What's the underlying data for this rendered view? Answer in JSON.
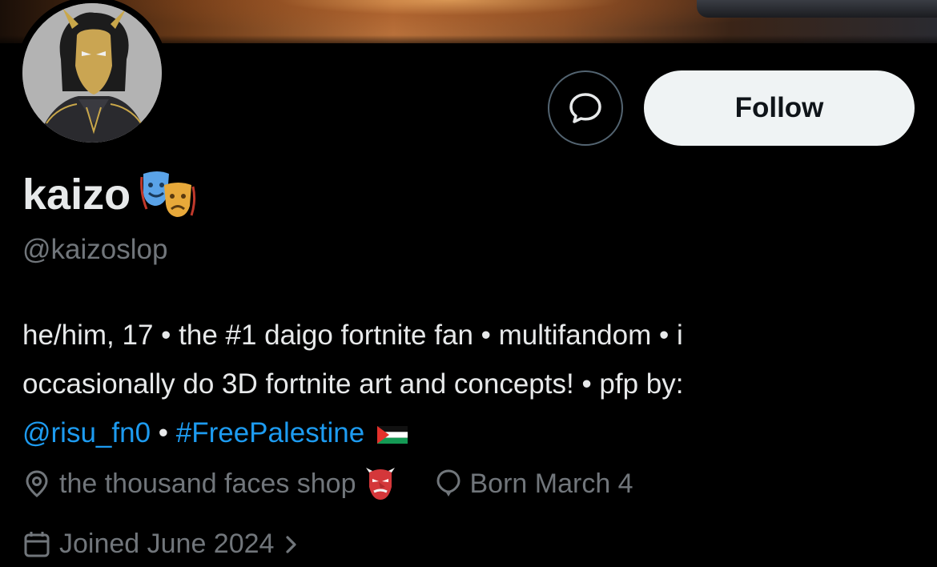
{
  "profile": {
    "display_name": "kaizo",
    "handle": "@kaizoslop",
    "follow_label": "Follow"
  },
  "bio": {
    "line1": "he/him, 17 • the #1 daigo fortnite fan • multifandom • i",
    "line2": "occasionally do 3D fortnite art and concepts! • pfp by:",
    "mention": "@risu_fn0",
    "separator": " • ",
    "hashtag": "#FreePalestine"
  },
  "meta": {
    "location": "the thousand faces shop",
    "birthday": "Born March 4",
    "joined": "Joined June 2024"
  },
  "icons": {
    "message": "message-bubble-icon",
    "location": "location-pin-icon",
    "birthday": "balloon-icon",
    "joined": "calendar-icon",
    "chevron": "chevron-right-icon",
    "name_emoji": "theater-masks-emoji",
    "location_emoji": "goblin-mask-emoji",
    "flag": "palestine-flag-emoji"
  },
  "colors": {
    "background": "#000000",
    "text": "#e7e9ea",
    "muted": "#71767b",
    "link": "#1d9bf0",
    "follow_bg": "#eff3f4"
  }
}
